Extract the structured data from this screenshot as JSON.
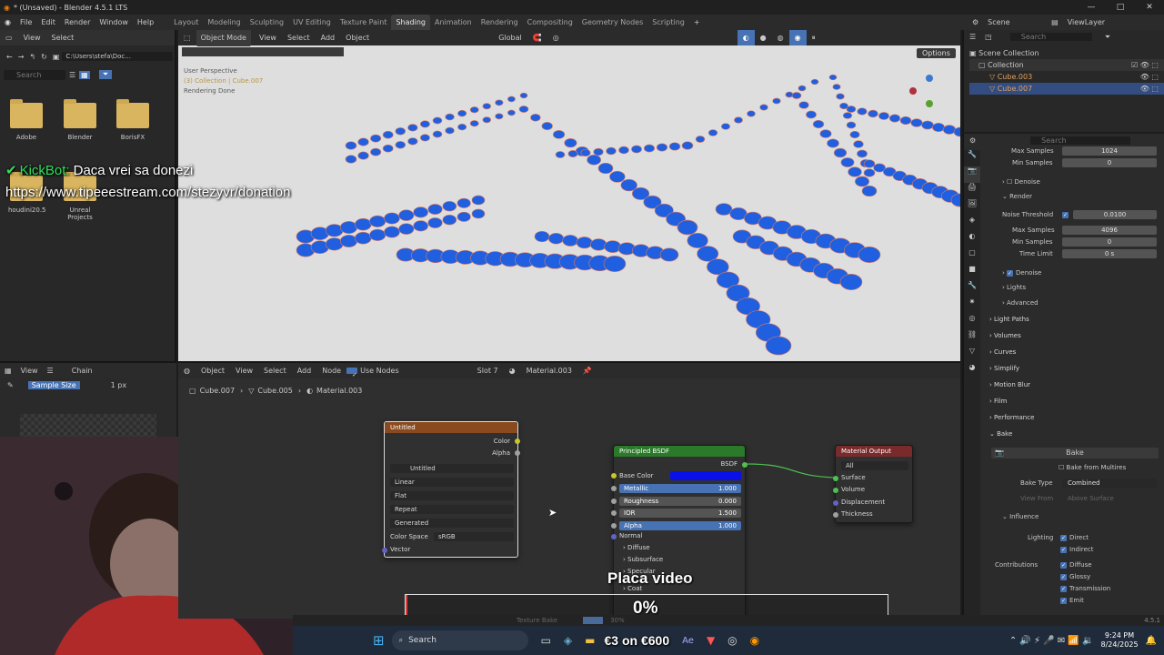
{
  "window": {
    "title": "* (Unsaved) - Blender 4.5.1 LTS"
  },
  "menu": {
    "items": [
      "File",
      "Edit",
      "Render",
      "Window",
      "Help"
    ],
    "workspaces": [
      "Layout",
      "Modeling",
      "Sculpting",
      "UV Editing",
      "Texture Paint",
      "Shading",
      "Animation",
      "Rendering",
      "Compositing",
      "Geometry Nodes",
      "Scripting"
    ],
    "active_workspace": "Shading",
    "scene": "Scene",
    "view_layer": "ViewLayer"
  },
  "file_browser": {
    "menu": [
      "View",
      "Select"
    ],
    "path": "C:\\Users\\stefa\\Doc...",
    "search_placeholder": "Search",
    "folders": [
      "Adobe",
      "Blender",
      "BorisFX",
      "houdini20.5",
      "Unreal Projects"
    ]
  },
  "viewport": {
    "mode": "Object Mode",
    "menu": [
      "View",
      "Select",
      "Add",
      "Object"
    ],
    "transform": "Global",
    "options": "Options",
    "info_lines": [
      "User Perspective",
      "(3) Collection | Cube.007",
      "Rendering Done"
    ]
  },
  "overlay": {
    "bot_name": "KickBot:",
    "bot_message": "Daca vrei sa donezi",
    "donation_url": "https://www.tipeeestream.com/stezyvr/donation",
    "gpu_label": "Placa video",
    "progress_text": "0%",
    "progress": 0.0,
    "price_text": "€3 on €600"
  },
  "image_editor": {
    "view": "View",
    "brush": "Chain",
    "sample_label": "Sample Size",
    "sample_value": "1 px"
  },
  "node_editor": {
    "type": "Object",
    "menu": [
      "View",
      "Select",
      "Add",
      "Node"
    ],
    "use_nodes": "Use Nodes",
    "slot": "Slot 7",
    "material": "Material.003",
    "breadcrumb": [
      "Cube.007",
      "Cube.005",
      "Material.003"
    ],
    "image_node": {
      "title": "Untitled",
      "outputs": [
        "Color",
        "Alpha"
      ],
      "image_name": "Untitled",
      "interpolation": "Linear",
      "projection": "Flat",
      "extension": "Repeat",
      "source": "Generated",
      "color_space_label": "Color Space",
      "color_space": "sRGB",
      "input": "Vector"
    },
    "bsdf_node": {
      "title": "Principled BSDF",
      "output": "BSDF",
      "base_color": "Base Color",
      "base_color_hex": "#0a10e8",
      "fields": [
        {
          "label": "Metallic",
          "value": "1.000",
          "fill": 1.0
        },
        {
          "label": "Roughness",
          "value": "0.000",
          "fill": 0.0
        },
        {
          "label": "IOR",
          "value": "1.500",
          "fill": 0.0
        },
        {
          "label": "Alpha",
          "value": "1.000",
          "fill": 1.0
        }
      ],
      "normal": "Normal",
      "panels": [
        "Diffuse",
        "Subsurface",
        "Specular",
        "Coat"
      ]
    },
    "output_node": {
      "title": "Material Output",
      "target": "All",
      "inputs": [
        "Surface",
        "Volume",
        "Displacement",
        "Thickness"
      ]
    }
  },
  "outliner": {
    "search_placeholder": "Search",
    "items": [
      "Scene Collection",
      "Collection",
      "Cube.003",
      "Cube.007"
    ]
  },
  "properties": {
    "search_placeholder": "Search",
    "rows": {
      "max_samples_top_label": "Max Samples",
      "max_samples_top": "1024",
      "min_samples_top_label": "Min Samples",
      "min_samples_top": "0",
      "denoise_1": "Denoise",
      "render": "Render",
      "noise_threshold_label": "Noise Threshold",
      "noise_threshold": "0.0100",
      "max_samples_label": "Max Samples",
      "max_samples": "4096",
      "min_samples_label": "Min Samples",
      "min_samples": "0",
      "time_limit_label": "Time Limit",
      "time_limit": "0 s",
      "denoise_2": "Denoise",
      "lights": "Lights",
      "advanced": "Advanced"
    },
    "sections": [
      "Light Paths",
      "Volumes",
      "Curves",
      "Simplify",
      "Motion Blur",
      "Film",
      "Performance",
      "Bake"
    ],
    "bake": {
      "bake_button": "Bake",
      "from_multires": "Bake from Multires",
      "bake_type_label": "Bake Type",
      "bake_type": "Combined",
      "view_from_label": "View From",
      "view_from": "Above Surface",
      "influence": "Influence",
      "lighting_label": "Lighting",
      "lighting": [
        "Direct",
        "Indirect"
      ],
      "contributions_label": "Contributions",
      "contributions": [
        "Diffuse",
        "Glossy",
        "Transmission",
        "Emit"
      ]
    }
  },
  "status": {
    "texture_bake": "Texture Bake",
    "percent": "30%",
    "version": "4.5.1"
  },
  "taskbar": {
    "search": "Search",
    "time": "9:24 PM",
    "date": "8/24/2025"
  },
  "colors": {
    "accent": "#4772b3",
    "bsdf_header": "#2a7a2a",
    "image_header": "#8a4a1f",
    "output_header": "#7a2a2a"
  }
}
